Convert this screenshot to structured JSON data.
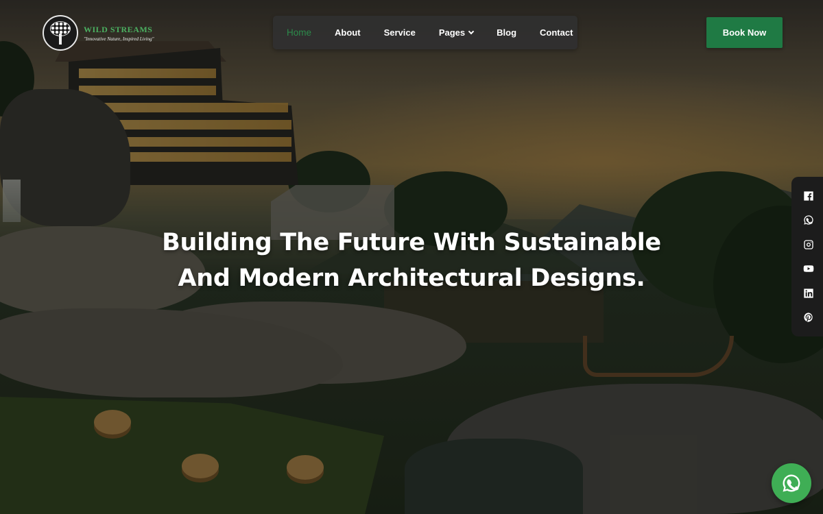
{
  "brand": {
    "name": "WILD STREAMS",
    "tagline": "\"Innovative Nature, Inspired Living\""
  },
  "nav": {
    "items": [
      {
        "label": "Home",
        "active": true
      },
      {
        "label": "About"
      },
      {
        "label": "Service"
      },
      {
        "label": "Pages",
        "has_dropdown": true
      },
      {
        "label": "Blog"
      },
      {
        "label": "Contact"
      }
    ],
    "cta_label": "Book Now"
  },
  "hero": {
    "line1": "Building The Future With Sustainable",
    "line2": "And Modern Architectural Designs."
  },
  "social": {
    "icons": [
      "facebook-icon",
      "whatsapp-icon",
      "instagram-icon",
      "youtube-icon",
      "linkedin-icon",
      "pinterest-icon"
    ]
  },
  "colors": {
    "accent": "#1f7a44",
    "nav_bg": "#303030",
    "active_link": "#2c8a4b",
    "whatsapp": "#3fae55"
  }
}
